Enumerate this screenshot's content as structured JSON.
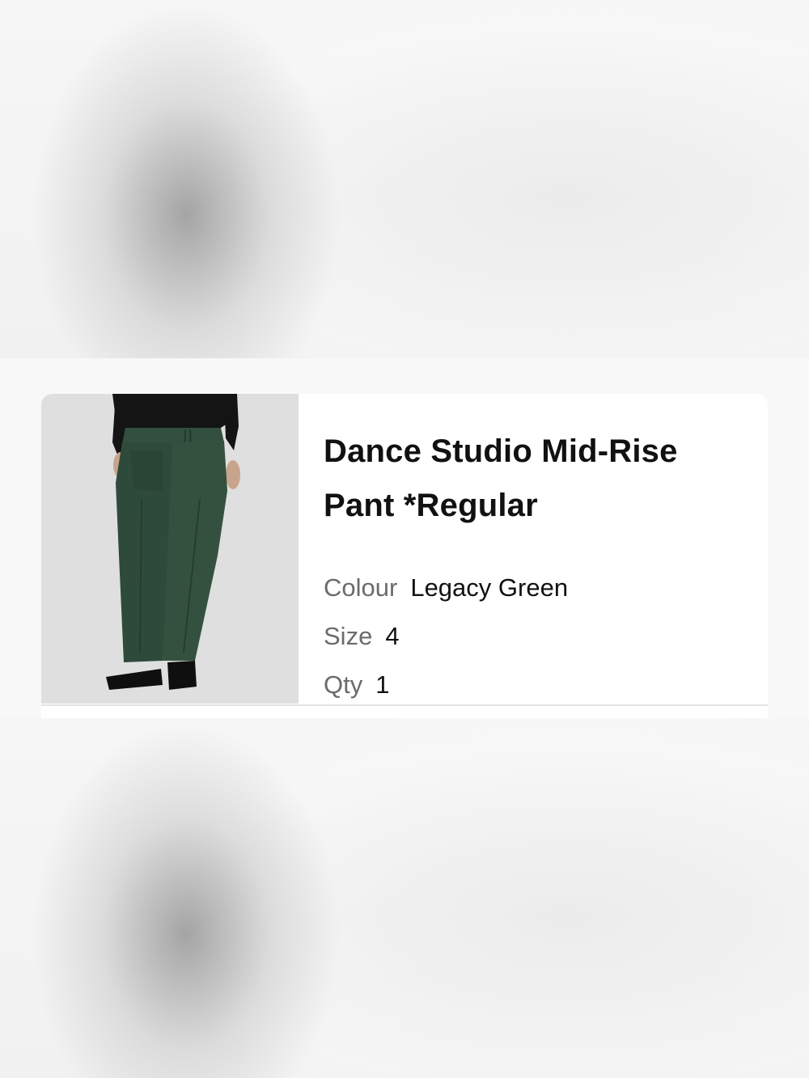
{
  "cart_item": {
    "name": "Dance Studio Mid-Rise Pant *Regular",
    "image": "green-pants-product-photo",
    "colour_label": "Colour",
    "colour_value": "Legacy Green",
    "size_label": "Size",
    "size_value": "4",
    "qty_label": "Qty",
    "qty_value": "1"
  },
  "colors": {
    "pant_green": "#2e4a3b",
    "photo_background": "#dedede",
    "card_background": "#ffffff",
    "label_grey": "#6b6b6b",
    "text": "#111111"
  }
}
